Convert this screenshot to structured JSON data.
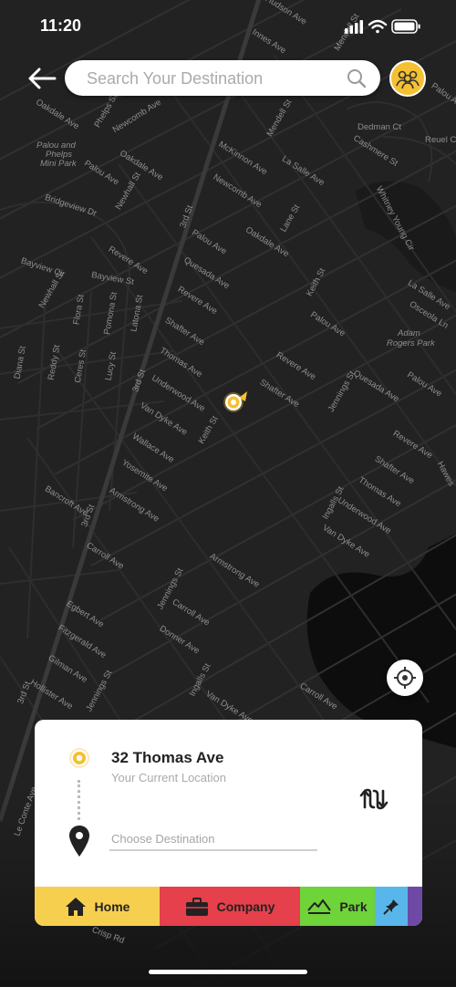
{
  "status_bar": {
    "time": "11:20"
  },
  "search": {
    "placeholder": "Search Your Destination"
  },
  "map": {
    "labels": [
      "Hudson Ave",
      "Innes Ave",
      "Mendell St",
      "Palou Ave",
      "Mendell St",
      "Oakdale Ave",
      "Phelps St",
      "Newcomb Ave",
      "Dedman Ct",
      "Reuel Ct",
      "Cashmere St",
      "Palou and",
      "Phelps",
      "Mini Park",
      "Palou Ave",
      "Oakdale Ave",
      "McKinnon Ave",
      "La Salle Ave",
      "Newhall St",
      "Newcomb Ave",
      "Whitney Young Cir",
      "Bridgeview Dr",
      "3rd St",
      "Lane St",
      "Palou Ave",
      "Oakdale Ave",
      "Revere Ave",
      "Quesada Ave",
      "Bayview Cir",
      "Bayview St",
      "Newhall St",
      "Keith St",
      "La Salle Ave",
      "Osceola Ln",
      "Flora St",
      "Pomona St",
      "Latona St",
      "Revere Ave",
      "Palou Ave",
      "Shafter Ave",
      "Adam",
      "Rogers Park",
      "Diana St",
      "Reddy St",
      "Ceres St",
      "Lucy St",
      "3rd St",
      "Thomas Ave",
      "Revere Ave",
      "Quesada Ave",
      "Palou Ave",
      "Shafter Ave",
      "Underwood Ave",
      "Jennings St",
      "Van Dyke Ave",
      "Keith St",
      "Wallace Ave",
      "Revere Ave",
      "Yosemite Ave",
      "Shafter Ave",
      "Bancroft Ave",
      "Armstrong Ave",
      "Thomas Ave",
      "Hawes",
      "3rd St",
      "Ingalls St",
      "Underwood Ave",
      "Van Dyke Ave",
      "Carroll Ave",
      "Armstrong Ave",
      "Jennings St",
      "Egbert Ave",
      "Carroll Ave",
      "Fitzgerald Ave",
      "Donner Ave",
      "Gilman Ave",
      "Hollister Ave",
      "Jennings St",
      "3rd St",
      "Ingalls St",
      "Carroll Ave",
      "Van Dyke Ave",
      "Le Conte Ave",
      "Crisp Rd"
    ]
  },
  "route": {
    "origin_title": "32 Thomas Ave",
    "origin_subtitle": "Your Current Location",
    "destination_placeholder": "Choose Destination"
  },
  "shortcuts": [
    {
      "label": "Home"
    },
    {
      "label": "Company"
    },
    {
      "label": "Park"
    }
  ],
  "colors": {
    "accent": "#f5c031",
    "home": "#f7cf4f",
    "company": "#e5404b",
    "park": "#6fd33a",
    "pin": "#58b6ea",
    "more": "#6e4aa6"
  },
  "icons": [
    "back-arrow-icon",
    "search-icon",
    "group-avatar-icon",
    "gps-locate-icon",
    "current-location-icon",
    "map-pin-icon",
    "swap-route-icon",
    "home-icon",
    "briefcase-icon",
    "mountain-icon",
    "pushpin-icon"
  ]
}
